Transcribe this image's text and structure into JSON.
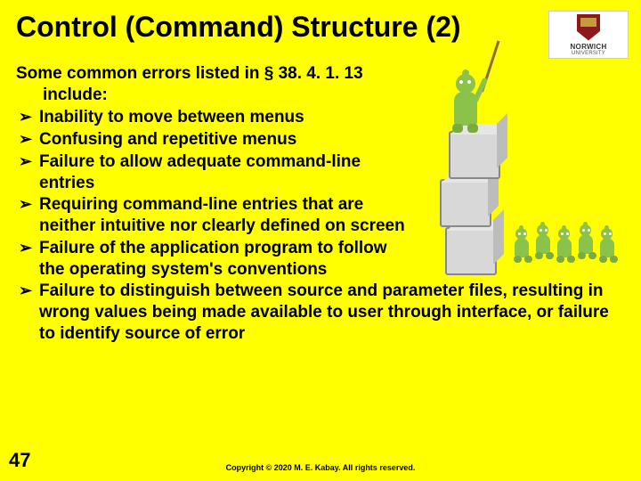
{
  "logo": {
    "name": "NORWICH",
    "sub": "UNIVERSITY"
  },
  "title": "Control (Command) Structure (2)",
  "intro_line1": "Some common errors listed in § 38. 4. 1. 13",
  "intro_line2": "include:",
  "bullets": [
    "Inability to move between menus",
    "Confusing and repetitive menus",
    "Failure to allow adequate command-line entries",
    "Requiring command-line entries that are neither intuitive nor clearly defined on screen",
    "Failure of the application program to follow the operating system's conventions",
    "Failure to distinguish between source and parameter files, resulting in wrong values being made available to user through interface, or failure to identify source of error"
  ],
  "page_number": "47",
  "copyright": "Copyright © 2020 M. E. Kabay. All rights reserved."
}
